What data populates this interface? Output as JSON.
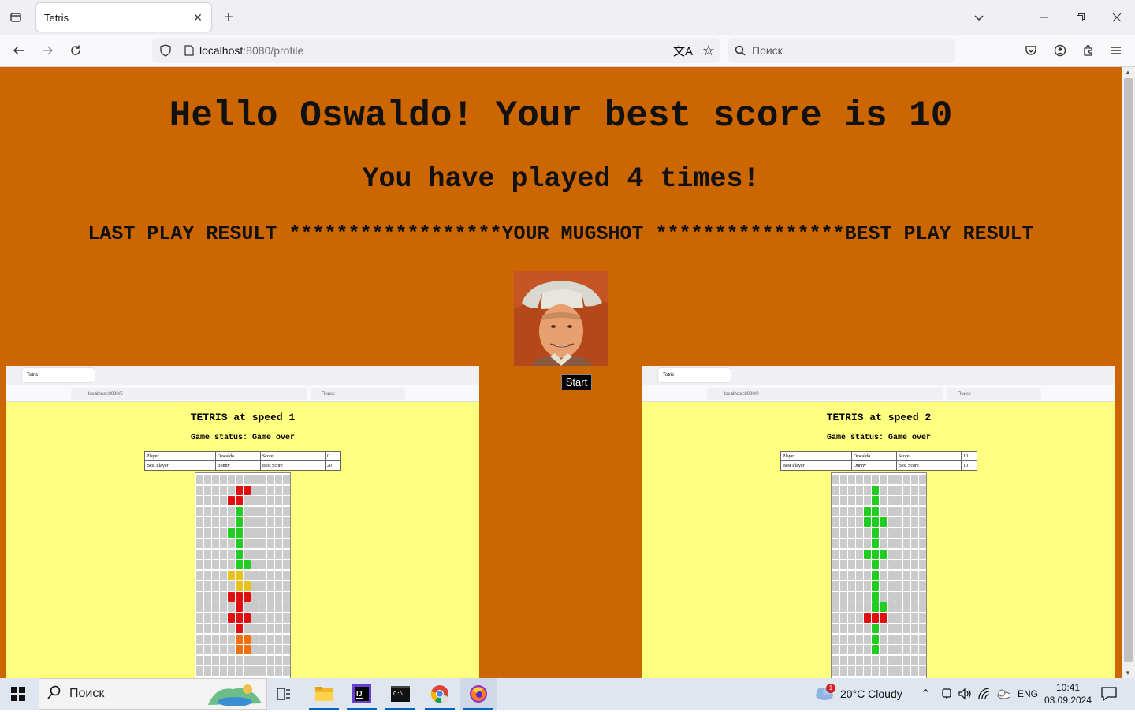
{
  "browser": {
    "tab_title": "Tetris",
    "url_host": "localhost",
    "url_path": ":8080/profile",
    "search_placeholder": "Поиск"
  },
  "page": {
    "greeting": "Hello Oswaldo! Your best score is 10",
    "played": "You have played 4 times!",
    "section_row": "LAST PLAY RESULT ******************YOUR MUGSHOT ****************BEST PLAY RESULT",
    "start_label": "Start"
  },
  "last_play": {
    "tab_title": "Tetris",
    "url": "localhost:8080/5",
    "search": "Поиск",
    "title": "TETRIS at speed 1",
    "status": "Game status: Game over",
    "table": [
      [
        "Player",
        "Oswaldo",
        "Score",
        "0"
      ],
      [
        "Best Player",
        "Bonny",
        "Best Score",
        "20"
      ]
    ]
  },
  "best_play": {
    "tab_title": "Tetris",
    "url": "localhost:8080/0",
    "search": "Поиск",
    "title": "TETRIS at speed 2",
    "status": "Game status: Game over",
    "table": [
      [
        "Player",
        "Oswaldo",
        "Score",
        "10"
      ],
      [
        "Best Player",
        "Dunny",
        "Best Score",
        "10"
      ]
    ]
  },
  "colors": {
    "page_bg": "#cc6600",
    "game_bg": "#ffff80",
    "block_empty": "#b8b8b8",
    "block_red": "#e01010",
    "block_green": "#22cc22",
    "block_yellow": "#e8c020",
    "block_orange": "#f07010"
  },
  "taskbar": {
    "search_label": "Поиск",
    "weather": "20°C  Cloudy",
    "lang": "ENG",
    "time": "10:41",
    "date": "03.09.2024",
    "weather_badge": "1"
  }
}
